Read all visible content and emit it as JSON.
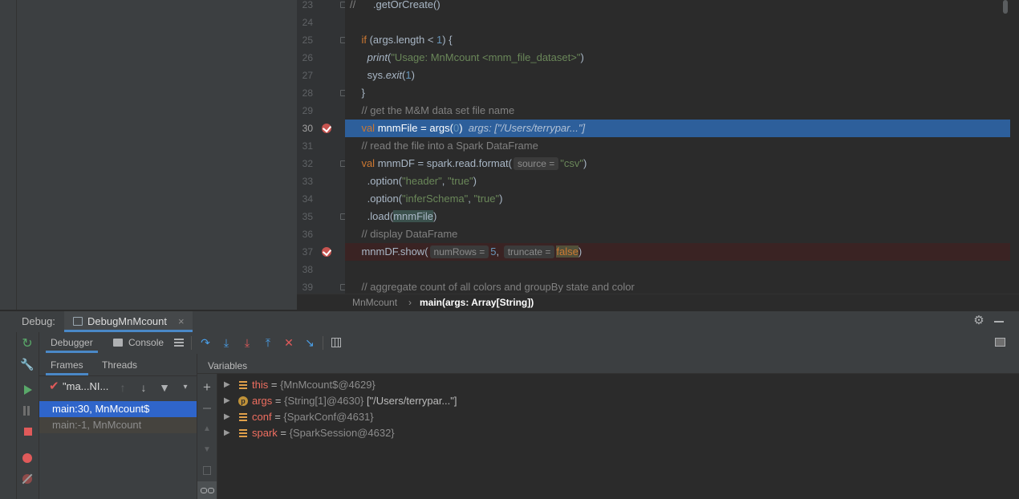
{
  "editor": {
    "lines": [
      {
        "num": "23",
        "fold": true,
        "bp": false,
        "type": "normal"
      },
      {
        "num": "24",
        "fold": false,
        "bp": false,
        "type": "normal"
      },
      {
        "num": "25",
        "fold": true,
        "bp": false,
        "type": "normal"
      },
      {
        "num": "26",
        "fold": false,
        "bp": false,
        "type": "normal"
      },
      {
        "num": "27",
        "fold": false,
        "bp": false,
        "type": "normal"
      },
      {
        "num": "28",
        "fold": true,
        "bp": false,
        "type": "normal"
      },
      {
        "num": "29",
        "fold": false,
        "bp": false,
        "type": "normal"
      },
      {
        "num": "30",
        "fold": false,
        "bp": true,
        "type": "exec"
      },
      {
        "num": "31",
        "fold": false,
        "bp": false,
        "type": "normal"
      },
      {
        "num": "32",
        "fold": true,
        "bp": false,
        "type": "normal"
      },
      {
        "num": "33",
        "fold": false,
        "bp": false,
        "type": "normal"
      },
      {
        "num": "34",
        "fold": false,
        "bp": false,
        "type": "normal"
      },
      {
        "num": "35",
        "fold": true,
        "bp": false,
        "type": "normal"
      },
      {
        "num": "36",
        "fold": false,
        "bp": false,
        "type": "normal"
      },
      {
        "num": "37",
        "fold": false,
        "bp": true,
        "type": "bpline"
      },
      {
        "num": "38",
        "fold": false,
        "bp": false,
        "type": "normal"
      },
      {
        "num": "39",
        "fold": true,
        "bp": false,
        "type": "normal"
      }
    ],
    "code": {
      "l23_comment": "//",
      "l23_code": "      .getOrCreate()",
      "l25_if": "if",
      "l25_a": " (args.length < ",
      "l25_num": "1",
      "l25_b": ") {",
      "l26_fn": "print",
      "l26_a": "(",
      "l26_str": "\"Usage: MnMcount <mnm_file_dataset>\"",
      "l26_b": ")",
      "l27_a": "sys.",
      "l27_fn": "exit",
      "l27_b": "(",
      "l27_num": "1",
      "l27_c": ")",
      "l28": "}",
      "l29": "// get the M&M data set file name",
      "l30_kw": "val",
      "l30_a": " mnmFile = args(",
      "l30_num": "0",
      "l30_b": ")",
      "l30_inline": "args: [\"/Users/terrypar...\"]",
      "l31": "// read the file into a Spark DataFrame",
      "l32_kw": "val",
      "l32_a": " mnmDF = spark.read.format(",
      "l32_hint": "source =",
      "l32_str": "\"csv\"",
      "l32_b": ")",
      "l33_a": ".option(",
      "l33_s1": "\"header\"",
      "l33_c": ", ",
      "l33_s2": "\"true\"",
      "l33_b": ")",
      "l34_a": ".option(",
      "l34_s1": "\"inferSchema\"",
      "l34_c": ", ",
      "l34_s2": "\"true\"",
      "l34_b": ")",
      "l35_a": ".load(",
      "l35_var": "mnmFile",
      "l35_b": ")",
      "l36": "// display DataFrame",
      "l37_a": "mnmDF.show(",
      "l37_hint1": "numRows =",
      "l37_num": "5",
      "l37_c": ",",
      "l37_hint2": "truncate =",
      "l37_false": "false",
      "l37_b": ")",
      "l39": "// aggregate count of all colors and groupBy state and color"
    }
  },
  "breadcrumb": {
    "item1": "MnMcount",
    "sep": "›",
    "item2": "main(args: Array[String])"
  },
  "debug": {
    "title": "Debug:",
    "session_tab": "DebugMnMcount",
    "close": "×",
    "tabs": {
      "debugger": "Debugger",
      "console": "Console"
    },
    "frames_tabs": {
      "frames": "Frames",
      "threads": "Threads"
    },
    "thread_selector": "\"ma...NI...",
    "frames": [
      {
        "label": "main:30, MnMcount$",
        "selected": true
      },
      {
        "label": "main:-1, MnMcount",
        "selected": false
      }
    ],
    "variables_header": "Variables",
    "variables": [
      {
        "name": "this",
        "eq": " = ",
        "value": "{MnMcount$@4629}",
        "extra": "",
        "icon": "stack"
      },
      {
        "name": "args",
        "eq": " = ",
        "value": "{String[1]@4630}",
        "extra": " [\"/Users/terrypar...\"]",
        "icon": "param"
      },
      {
        "name": "conf",
        "eq": " = ",
        "value": "{SparkConf@4631}",
        "extra": "",
        "icon": "stack"
      },
      {
        "name": "spark",
        "eq": " = ",
        "value": "{SparkSession@4632}",
        "extra": "",
        "icon": "stack"
      }
    ],
    "param_icon_letter": "p"
  },
  "colors": {
    "exec_line": "#2d5f9b",
    "selection": "#2f65ca",
    "breakpoint": "#c75450",
    "var_name": "#ef6e60"
  }
}
